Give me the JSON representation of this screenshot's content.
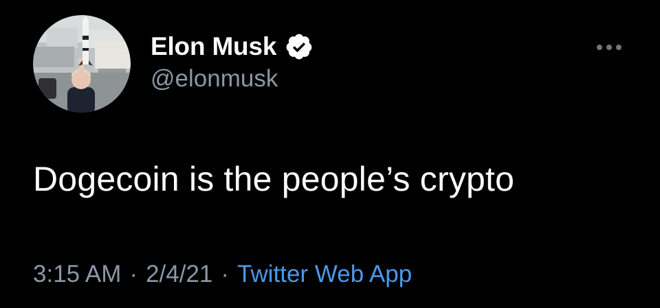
{
  "author": {
    "display_name": "Elon Musk",
    "handle": "@elonmusk",
    "verified": true,
    "avatar_icon": "profile-photo-child-holding-rocket"
  },
  "icons": {
    "verified": "verified-badge-icon",
    "more": "more-options-icon"
  },
  "tweet": {
    "text": "Dogecoin is the people’s crypto"
  },
  "meta": {
    "time": "3:15 AM",
    "separator": "·",
    "date": "2/4/21",
    "source": "Twitter Web App"
  },
  "colors": {
    "background": "#000000",
    "text_primary": "#ffffff",
    "text_secondary": "#8b98a5",
    "link": "#4a99e9",
    "verified_badge": "#ffffff"
  }
}
